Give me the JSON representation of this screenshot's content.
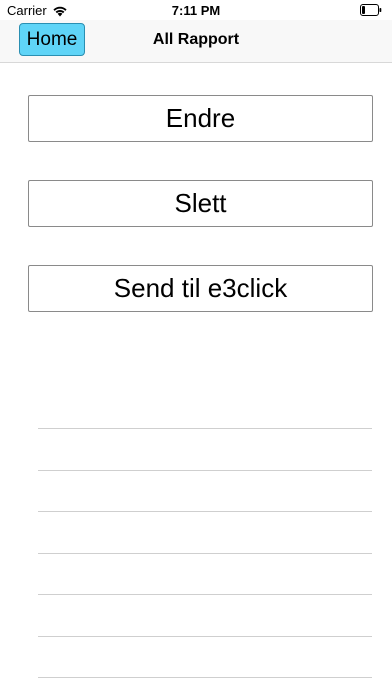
{
  "status_bar": {
    "carrier": "Carrier",
    "time": "7:11 PM",
    "wifi_icon": "wifi-icon",
    "battery_icon": "battery-icon"
  },
  "nav": {
    "home_label": "Home",
    "title": "All Rapport"
  },
  "actions": {
    "edit_label": "Endre",
    "delete_label": "Slett",
    "send_label": "Send til e3click"
  },
  "colors": {
    "home_button_bg": "#5fd4f7",
    "separator": "#cfcfcf"
  }
}
